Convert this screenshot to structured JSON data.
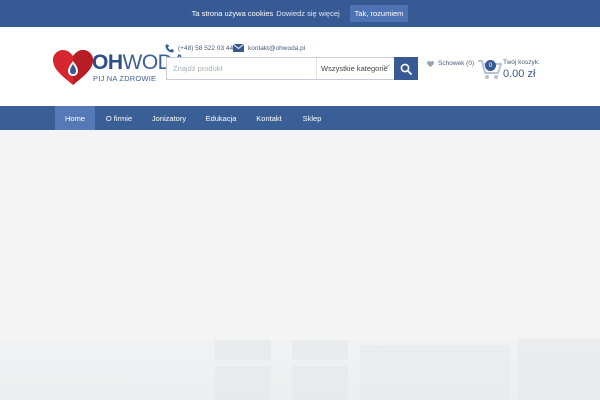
{
  "cookie": {
    "text": "Ta strona używa cookies",
    "link": "Dowiedz się więcej",
    "button": "Tak, rozumiem"
  },
  "logo": {
    "brand_oh": "OH",
    "brand_woda": "WODA",
    "tagline": "PIJ NA ZDROWIE"
  },
  "contact": {
    "phone": "(+48) 58 522 03 44",
    "email": "kontakt@ohwoda.pl"
  },
  "search": {
    "placeholder": "Znajdź produkt",
    "category": "Wszystkie kategorie"
  },
  "wishlist": {
    "label": "Schowek (0)"
  },
  "cart": {
    "count": "0",
    "label": "Twój koszyk:",
    "total": "0.00 zł"
  },
  "nav": {
    "items": [
      {
        "label": "Home"
      },
      {
        "label": "O firmie"
      },
      {
        "label": "Jonizatory"
      },
      {
        "label": "Edukacja"
      },
      {
        "label": "Kontakt"
      },
      {
        "label": "Sklep"
      }
    ]
  },
  "colors": {
    "brand_blue": "#375a94",
    "nav_active": "#5479b6",
    "logo_red": "#d7262f"
  }
}
